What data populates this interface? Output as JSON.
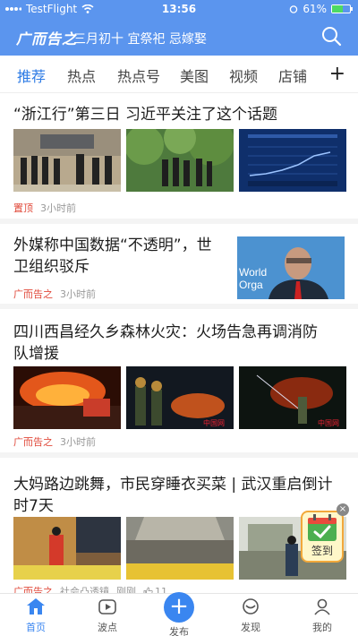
{
  "status_bar": {
    "carrier": "TestFlight",
    "time": "13:56",
    "battery": "61%"
  },
  "header": {
    "logo": "广而告之",
    "almanac": "三月初十 宜祭祀 忌嫁娶",
    "search_icon": "search-icon"
  },
  "tabs": [
    {
      "label": "推荐",
      "active": true
    },
    {
      "label": "热点"
    },
    {
      "label": "热点号"
    },
    {
      "label": "美图"
    },
    {
      "label": "视频"
    },
    {
      "label": "店铺"
    }
  ],
  "tabs_plus": "+",
  "articles": [
    {
      "title": "“浙江行”第三日 习近平关注了这个话题",
      "tag": "置顶",
      "time": "3小时前"
    },
    {
      "title_line1": "外媒称中国数据“不透明”，世",
      "title_line2": "卫组织驳斥",
      "tag": "广而告之",
      "time": "3小时前",
      "thumb_text_1": "World",
      "thumb_text_2": "Orga"
    },
    {
      "title_line1": "四川西昌经久乡森林火灾：火场告急再调消防",
      "title_line2": "队增援",
      "tag": "广而告之",
      "time": "3小时前",
      "watermark": "中国网"
    },
    {
      "title_line1": "大妈路边跳舞，市民穿睡衣买菜 | 武汉重启倒计",
      "title_line2": "时7天",
      "tag": "广而告之",
      "source": "社会凸透镜",
      "time": "刚刚",
      "likes": "11"
    }
  ],
  "checkin": {
    "label": "签到",
    "close": "×"
  },
  "bottom_nav": [
    {
      "label": "首页",
      "icon": "home-icon",
      "active": true
    },
    {
      "label": "波点",
      "icon": "video-icon"
    },
    {
      "label": "发布",
      "icon": "publish-icon"
    },
    {
      "label": "发现",
      "icon": "discover-icon"
    },
    {
      "label": "我的",
      "icon": "profile-icon"
    }
  ],
  "colors": {
    "brand": "#5b95ee",
    "accent": "#2d7be5",
    "tag_red": "#e0493a"
  }
}
